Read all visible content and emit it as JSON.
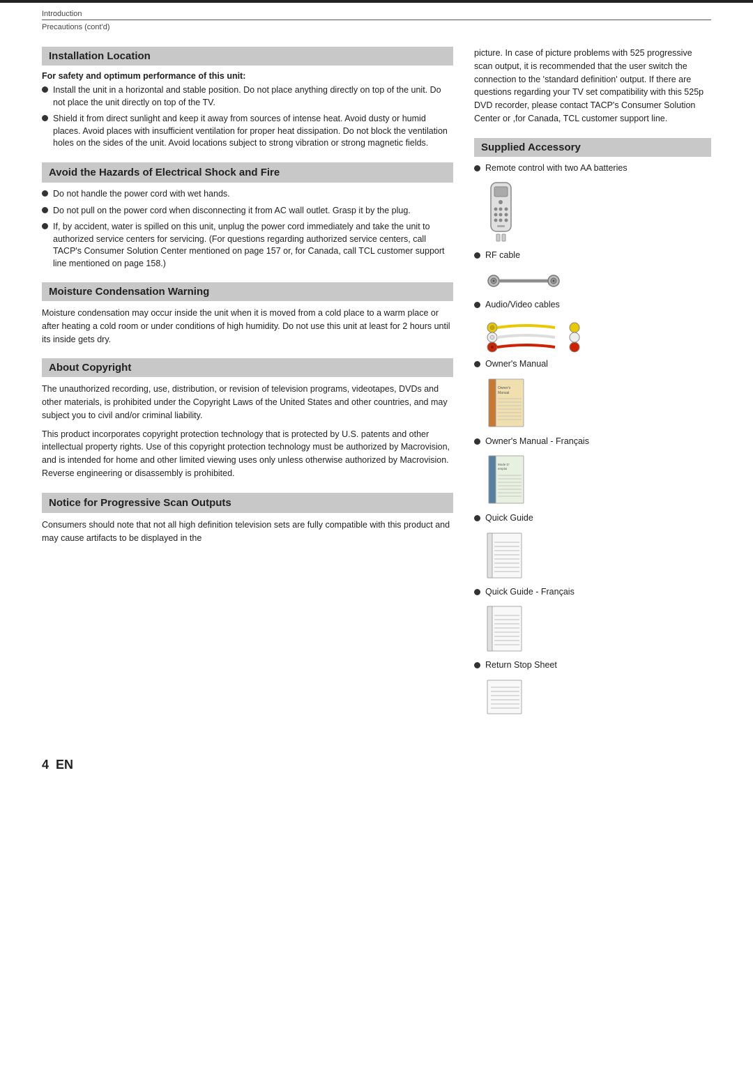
{
  "header": {
    "top_label": "Introduction",
    "sub_label": "Precautions (cont'd)"
  },
  "left_column": {
    "installation_location": {
      "title": "Installation Location",
      "bold_label": "For safety and optimum performance of this unit:",
      "bullets": [
        "Install the unit in a horizontal and stable position. Do not place anything directly on top of the unit. Do not place the unit directly on top of the TV.",
        "Shield it from direct sunlight and keep it away from sources of intense heat. Avoid dusty or humid places. Avoid places with insufficient ventilation for proper heat dissipation. Do not block the ventilation holes on the sides of the unit.  Avoid locations subject to strong vibration or strong magnetic fields."
      ]
    },
    "avoid_hazards": {
      "title": "Avoid the Hazards of Electrical Shock and Fire",
      "bullets": [
        "Do not handle the power cord with wet hands.",
        "Do not pull on the power cord when disconnecting it from AC wall outlet. Grasp it by the plug.",
        "If, by accident, water is spilled on this unit, unplug the power cord immediately and take the unit to authorized service centers for servicing. (For questions regarding authorized service centers, call TACP's Consumer Solution Center mentioned on page 157 or, for Canada, call TCL customer support line mentioned on page 158.)"
      ]
    },
    "moisture": {
      "title": "Moisture Condensation Warning",
      "text": "Moisture condensation may occur inside the unit when it is moved from a cold place to a warm place or after heating a cold room or under conditions of high humidity. Do not use this unit at least for 2 hours until its inside gets dry."
    },
    "copyright": {
      "title": "About Copyright",
      "paragraphs": [
        "The unauthorized recording, use, distribution, or revision of television programs, videotapes, DVDs and other materials, is prohibited under the Copyright Laws of the United States and other countries, and may subject you to civil and/or criminal liability.",
        "This product incorporates copyright protection technology that is protected by U.S. patents and other intellectual property rights. Use of this copyright protection technology must be authorized by Macrovision, and is intended for home and other limited viewing uses only unless otherwise authorized by Macrovision. Reverse engineering or disassembly is prohibited."
      ]
    },
    "progressive_scan": {
      "title": "Notice for Progressive Scan Outputs",
      "text": "Consumers should note that not all high definition television sets are fully compatible with this product and may cause artifacts to be displayed in the"
    }
  },
  "right_column": {
    "progressive_scan_cont": "picture.  In case of picture problems with 525 progressive scan output, it is recommended that the user switch the connection to the 'standard definition' output. If there are questions regarding your TV set compatibility with this 525p DVD recorder, please contact TACP's Consumer Solution Center or ,for Canada, TCL customer support line.",
    "supplied_accessory": {
      "title": "Supplied Accessory",
      "items": [
        {
          "label": "Remote control with two AA batteries",
          "has_image": true,
          "image_type": "remote"
        },
        {
          "label": "RF cable",
          "has_image": true,
          "image_type": "rf_cable"
        },
        {
          "label": "Audio/Video cables",
          "has_image": true,
          "image_type": "av_cables"
        },
        {
          "label": "Owner's Manual",
          "has_image": true,
          "image_type": "manual_orange"
        },
        {
          "label": "Owner's Manual - Français",
          "has_image": true,
          "image_type": "manual_blue"
        },
        {
          "label": "Quick Guide",
          "has_image": true,
          "image_type": "quick_guide"
        },
        {
          "label": "Quick Guide - Français",
          "has_image": true,
          "image_type": "quick_guide2"
        },
        {
          "label": "Return Stop Sheet",
          "has_image": true,
          "image_type": "return_sheet"
        }
      ]
    }
  },
  "footer": {
    "page_number": "4",
    "page_lang": "EN"
  }
}
